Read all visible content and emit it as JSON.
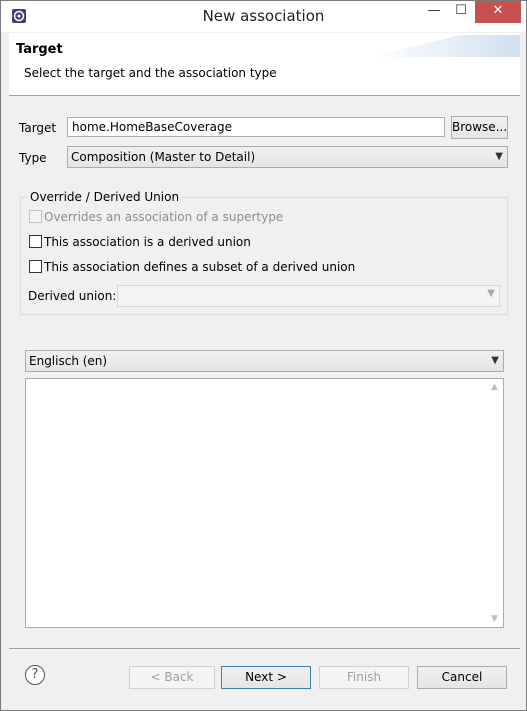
{
  "window": {
    "title": "New association",
    "minimize": "—",
    "maximize": "☐",
    "close": "✕"
  },
  "header": {
    "title": "Target",
    "description": "Select the target and the association type"
  },
  "target": {
    "label": "Target",
    "value": "home.HomeBaseCoverage",
    "browse_label": "Browse..."
  },
  "type": {
    "label": "Type",
    "selected": "Composition (Master to Detail)"
  },
  "override_group": {
    "title": "Override / Derived Union",
    "overrides_label": "Overrides an association of a supertype",
    "derived_union_label": "This association is a derived union",
    "subset_label": "This association defines a subset of a derived union",
    "derived_union_field_label": "Derived union:",
    "overrides_checked": false,
    "derived_union_checked": false,
    "subset_checked": false
  },
  "language": {
    "selected": "Englisch (en)"
  },
  "description_text": "",
  "footer": {
    "help": "?",
    "back": "< Back",
    "next": "Next >",
    "finish": "Finish",
    "cancel": "Cancel"
  }
}
